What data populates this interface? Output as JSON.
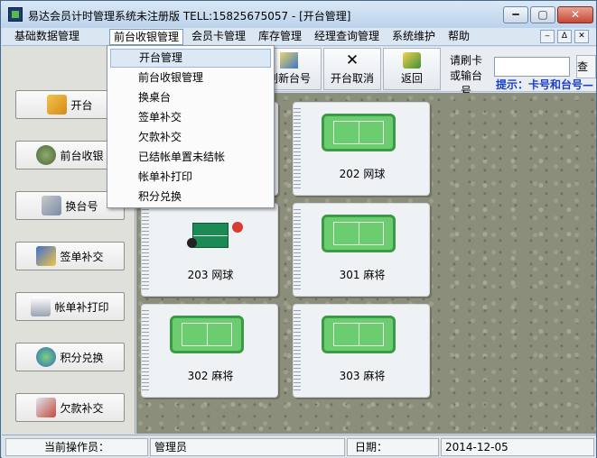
{
  "window": {
    "title": "易达会员计时管理系统未注册版 TELL:15825675057 - [开台管理]",
    "min_label": "━",
    "max_label": "▢",
    "close_label": "✕"
  },
  "menubar": {
    "items": [
      {
        "label": "基础数据管理"
      },
      {
        "label": "前台收银管理"
      },
      {
        "label": "会员卡管理"
      },
      {
        "label": "库存管理"
      },
      {
        "label": "经理查询管理"
      },
      {
        "label": "系统维护"
      },
      {
        "label": "帮助"
      }
    ],
    "mdi": [
      "‒",
      "ᐃ",
      "✕"
    ]
  },
  "dropdown": {
    "items": [
      {
        "label": "开台管理",
        "selected": true
      },
      {
        "label": "前台收银管理"
      },
      {
        "label": "换桌台"
      },
      {
        "label": "签单补交"
      },
      {
        "label": "欠款补交"
      },
      {
        "label": "已结帐单置未结帐"
      },
      {
        "label": "帐单补打印"
      },
      {
        "label": "积分兑换"
      }
    ]
  },
  "sidebar": {
    "buttons": [
      {
        "label": "开台",
        "icon": "open-table-icon"
      },
      {
        "label": "前台收银",
        "icon": "money-bag-icon"
      },
      {
        "label": "换台号",
        "icon": "swap-table-icon"
      },
      {
        "label": "签单补交",
        "icon": "sign-bill-icon"
      },
      {
        "label": "帐单补打印",
        "icon": "printer-icon"
      },
      {
        "label": "积分兑换",
        "icon": "points-exchange-icon"
      },
      {
        "label": "欠款补交",
        "icon": "debt-payment-icon"
      }
    ]
  },
  "toolbar": {
    "refresh_label": "刷新台号",
    "cancel_label": "开台取消",
    "back_label": "返回",
    "card_label": "请刷卡或输台号",
    "card_value": "",
    "query_label": "查",
    "hint": "提示：卡号和台号—"
  },
  "tables": [
    {
      "label": "",
      "kind": "court"
    },
    {
      "label": "202 网球",
      "kind": "court"
    },
    {
      "label": "203 网球",
      "kind": "pingpong"
    },
    {
      "label": "301 麻将",
      "kind": "court"
    },
    {
      "label": "302 麻将",
      "kind": "court"
    },
    {
      "label": "303 麻将",
      "kind": "court"
    }
  ],
  "statusbar": {
    "operator_label": "当前操作员：",
    "operator_value": "管理员",
    "date_label": "日期：",
    "date_value": "2014-12-05"
  }
}
